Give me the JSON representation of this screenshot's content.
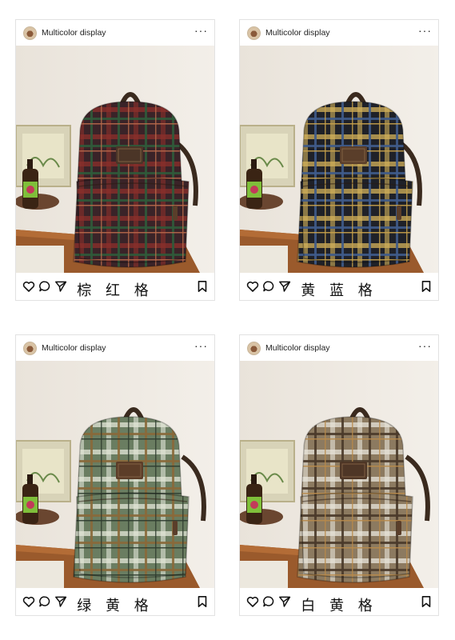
{
  "posts": [
    {
      "username": "Multicolor display",
      "more": "···",
      "caption": "棕 红 格",
      "colors": {
        "base": "#3a2328",
        "line1": "#8c2f2a",
        "line2": "#2f5a3a",
        "line3": "#b86a4a",
        "patch": "#4b3527"
      }
    },
    {
      "username": "Multicolor display",
      "more": "···",
      "caption": "黄 蓝 格",
      "colors": {
        "base": "#1f2128",
        "line1": "#d4b25a",
        "line2": "#3f5b8a",
        "line3": "#c9a24a",
        "patch": "#5a3e2a"
      }
    },
    {
      "username": "Multicolor display",
      "more": "···",
      "caption": "绿 黄 格",
      "colors": {
        "base": "#6a7d61",
        "line1": "#e2e6d8",
        "line2": "#8a6a3a",
        "line3": "#2e3b2e",
        "patch": "#5c3d28"
      }
    },
    {
      "username": "Multicolor display",
      "more": "···",
      "caption": "白 黄 格",
      "colors": {
        "base": "#8c7a60",
        "line1": "#e8e4da",
        "line2": "#4a3a2a",
        "line3": "#b88a4a",
        "patch": "#4e3626"
      }
    }
  ],
  "icons": {
    "like": "heart-icon",
    "comment": "comment-icon",
    "share": "send-icon",
    "save": "bookmark-icon",
    "more": "more-icon"
  }
}
